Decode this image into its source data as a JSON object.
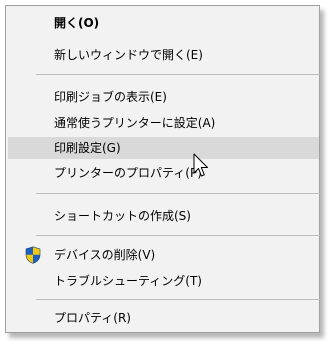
{
  "menu": {
    "items": [
      {
        "label": "開く(O)",
        "bold": true
      },
      {
        "label": "新しいウィンドウで開く(E)"
      },
      {
        "label": "印刷ジョブの表示(E)"
      },
      {
        "label": "通常使うプリンターに設定(A)"
      },
      {
        "label": "印刷設定(G)",
        "highlighted": true
      },
      {
        "label": "プリンターのプロパティ(P)"
      },
      {
        "label": "ショートカットの作成(S)"
      },
      {
        "label": "デバイスの削除(V)",
        "icon": "uac-shield-icon"
      },
      {
        "label": "トラブルシューティング(T)"
      },
      {
        "label": "プロパティ(R)"
      }
    ]
  },
  "colors": {
    "menu_bg": "#f2f2f2",
    "hover_bg": "#d9d9d9",
    "separator": "#bdbdbd",
    "border": "#a0a0a0",
    "shield_blue": "#1f5fbf",
    "shield_yellow": "#f2c811"
  },
  "cursor": "arrow-cursor-icon"
}
